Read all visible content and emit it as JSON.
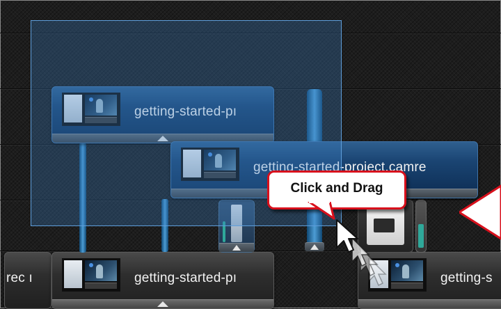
{
  "timeline": {
    "clips": [
      {
        "label": "getting-started-pı"
      },
      {
        "label": "getting-started-project.camre"
      },
      {
        "label": "getting-started-pı"
      },
      {
        "label": "getting-s"
      },
      {
        "label": "rec ı"
      }
    ]
  },
  "callout": {
    "text": "Click and Drag"
  },
  "icons": {
    "cursor": "mouse-pointer-icon",
    "handle": "collapse-triangle-icon",
    "arrow": "callout-arrow-icon"
  },
  "colors": {
    "callout_border": "#d8101c",
    "selection": "#5f9fdc",
    "clip_blue": "#1a4472"
  }
}
